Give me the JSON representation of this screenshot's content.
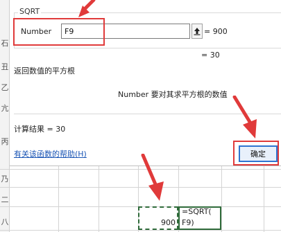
{
  "dialog": {
    "function_name": "SQRT",
    "argument": {
      "label": "Number",
      "value": "F9",
      "result": "= 900"
    },
    "function_result": "= 30",
    "function_description": "返回数值的平方根",
    "argument_description": "Number   要对其求平方根的数值",
    "calc_result": "计算结果 =    30",
    "help_link": "有关该函数的帮助(H)",
    "ok_label": "确定",
    "ref_icon": "collapse-dialog-icon"
  },
  "sheet": {
    "row_header_chars": [
      "石",
      "丑",
      "乙",
      "亢",
      "丙",
      "乃",
      "二",
      "八"
    ],
    "formula_cell": {
      "line1": "=SQRT(",
      "line2": "F9)"
    },
    "source_cell": {
      "value": "900"
    }
  },
  "annotations": {
    "highlight_color": "#e03a3a",
    "accent_color": "#2f74d0",
    "selection_color": "#2f6b3a"
  }
}
